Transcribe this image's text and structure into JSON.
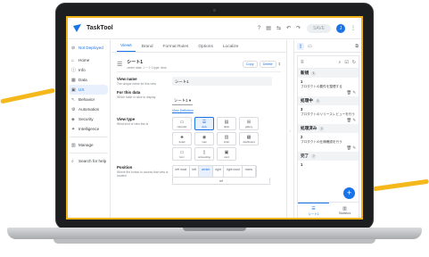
{
  "colors": {
    "accent": "#1a73e8",
    "highlight": "#f2b41a",
    "device": "#1d1e20"
  },
  "topbar": {
    "app_title": "TaskTool",
    "icons": [
      "help-icon",
      "docs-icon",
      "share-icon",
      "undo-icon",
      "redo-icon"
    ],
    "save_label": "SAVE",
    "avatar_letter": "J",
    "more_icon": "more-vert-icon"
  },
  "sidebar": {
    "deploy_label": "Not Deployed",
    "items": [
      {
        "label": "Home",
        "icon": "home-icon",
        "active": false
      },
      {
        "label": "Info",
        "icon": "info-icon",
        "active": false
      },
      {
        "label": "Data",
        "icon": "data-icon",
        "active": false
      },
      {
        "label": "UX",
        "icon": "ux-icon",
        "active": true
      },
      {
        "label": "Behavior",
        "icon": "behavior-icon",
        "active": false
      },
      {
        "label": "Automation",
        "icon": "automation-icon",
        "active": false
      },
      {
        "label": "Security",
        "icon": "security-icon",
        "active": false
      },
      {
        "label": "Intelligence",
        "icon": "intelligence-icon",
        "active": false
      }
    ],
    "manage_label": "Manage",
    "search_label": "Search for help"
  },
  "main": {
    "tabs": [
      "Views",
      "Brand",
      "Format Rules",
      "Options",
      "Localize"
    ],
    "active_tab": "Views",
    "view_header": {
      "name": "シート1",
      "sub": "center  data: シート1  type: deck",
      "copy_label": "Copy",
      "delete_label": "Delete"
    },
    "view_name": {
      "title": "View name",
      "sub": "The unique name for this view",
      "value": "シート1"
    },
    "for_this_data": {
      "title": "For this data",
      "sub": "Which table or slice to display",
      "value": "シート1",
      "link": "View Definition"
    },
    "view_type": {
      "title": "View type",
      "sub": "What kind of view this is",
      "types": [
        {
          "label": "calendar",
          "icon": "calendar-icon"
        },
        {
          "label": "deck",
          "icon": "deck-icon"
        },
        {
          "label": "table",
          "icon": "table-icon"
        },
        {
          "label": "gallery",
          "icon": "gallery-icon"
        },
        {
          "label": "detail",
          "icon": "detail-icon"
        },
        {
          "label": "map",
          "icon": "map-icon"
        },
        {
          "label": "chart",
          "icon": "chart-icon"
        },
        {
          "label": "dashboard",
          "icon": "dashboard-icon"
        },
        {
          "label": "form",
          "icon": "form-icon"
        },
        {
          "label": "onboarding",
          "icon": "onboarding-icon"
        },
        {
          "label": "card",
          "icon": "card-icon"
        }
      ],
      "selected": "deck"
    },
    "position": {
      "title": "Position",
      "sub": "Where the button to access that view is located",
      "options": [
        "left most",
        "left",
        "center",
        "right",
        "right most",
        "menu"
      ],
      "selected": "center",
      "second_row": "ref"
    }
  },
  "preview": {
    "device_tab": "phone-icon",
    "tablet_tab": "tablet-icon",
    "open_icon": "open-in-new-icon",
    "groups": [
      {
        "name": "新規",
        "count": "1",
        "cards": [
          {
            "num": "1",
            "title": "プロダクトの要件を整理する"
          }
        ]
      },
      {
        "name": "処理中",
        "count": "1",
        "cards": [
          {
            "num": "3",
            "title": "プロダクトのリリースレビューを行う"
          }
        ]
      },
      {
        "name": "処理済み",
        "count": "1",
        "cards": [
          {
            "num": "2",
            "title": "プロダクトの仕様確認を行う"
          }
        ]
      },
      {
        "name": "完了",
        "count": "?",
        "cards": [
          {
            "num": "1",
            "title": ""
          }
        ]
      }
    ],
    "nav": [
      {
        "label": "シート1",
        "icon": "list-icon",
        "active": true
      },
      {
        "label": "Statistics",
        "icon": "chart-icon",
        "active": false
      }
    ]
  }
}
